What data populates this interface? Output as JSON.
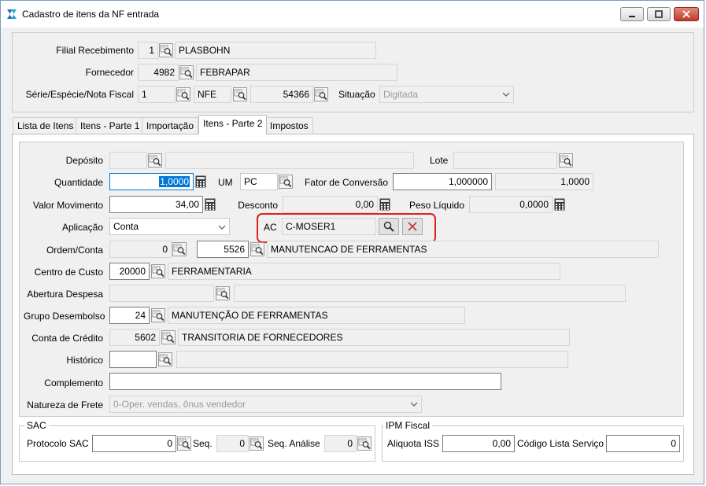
{
  "window": {
    "title": "Cadastro de itens da NF entrada"
  },
  "header": {
    "filial_label": "Filial Recebimento",
    "filial_code": "1",
    "filial_name": "PLASBOHN",
    "fornecedor_label": "Fornecedor",
    "fornecedor_code": "4982",
    "fornecedor_name": "FEBRAPAR",
    "serie_label": "Série/Espécie/Nota Fiscal",
    "serie": "1",
    "especie": "NFE",
    "nota": "54366",
    "situacao_label": "Situação",
    "situacao": "Digitada"
  },
  "tabs": [
    {
      "label": "Lista de Itens"
    },
    {
      "label": "Itens - Parte 1"
    },
    {
      "label": "Importação"
    },
    {
      "label": "Itens - Parte 2"
    },
    {
      "label": "Impostos"
    }
  ],
  "form": {
    "deposito_label": "Depósito",
    "lote_label": "Lote",
    "quantidade_label": "Quantidade",
    "quantidade": "1,0000",
    "um_label": "UM",
    "um": "PC",
    "fator_label": "Fator de Conversão",
    "fator": "1,000000",
    "fator_result": "1,0000",
    "valor_label": "Valor Movimento",
    "valor": "34,00",
    "desconto_label": "Desconto",
    "desconto": "0,00",
    "peso_label": "Peso Líquido",
    "peso": "0,0000",
    "aplicacao_label": "Aplicação",
    "aplicacao": "Conta",
    "ac_label": "AC",
    "ac_value": "C-MOSER1",
    "ordem_label": "Ordem/Conta",
    "ordem": "0",
    "conta_code": "5526",
    "conta_name": "MANUTENCAO DE FERRAMENTAS",
    "centro_label": "Centro de Custo",
    "centro_code": "20000",
    "centro_name": "FERRAMENTARIA",
    "abertura_label": "Abertura Despesa",
    "grupo_label": "Grupo Desembolso",
    "grupo_code": "24",
    "grupo_name": "MANUTENÇÃO DE FERRAMENTAS",
    "credito_label": "Conta de Crédito",
    "credito_code": "5602",
    "credito_name": "TRANSITORIA DE FORNECEDORES",
    "historico_label": "Histórico",
    "complemento_label": "Complemento",
    "natureza_label": "Natureza de Frete",
    "natureza": "0-Oper. vendas, ônus vendedor"
  },
  "sac": {
    "group_label": "SAC",
    "protocolo_label": "Protocolo SAC",
    "protocolo": "0",
    "seq_label": "Seq.",
    "seq": "0",
    "seq_analise_label": "Seq. Análise",
    "seq_analise": "0"
  },
  "ipm": {
    "group_label": "IPM Fiscal",
    "aliquota_label": "Aliquota ISS",
    "aliquota": "0,00",
    "codigo_label": "Código Lista Serviço",
    "codigo": "0"
  },
  "colors": {
    "highlight": "#e02020",
    "selection": "#0078d7",
    "accent": "#1e6fb5"
  }
}
